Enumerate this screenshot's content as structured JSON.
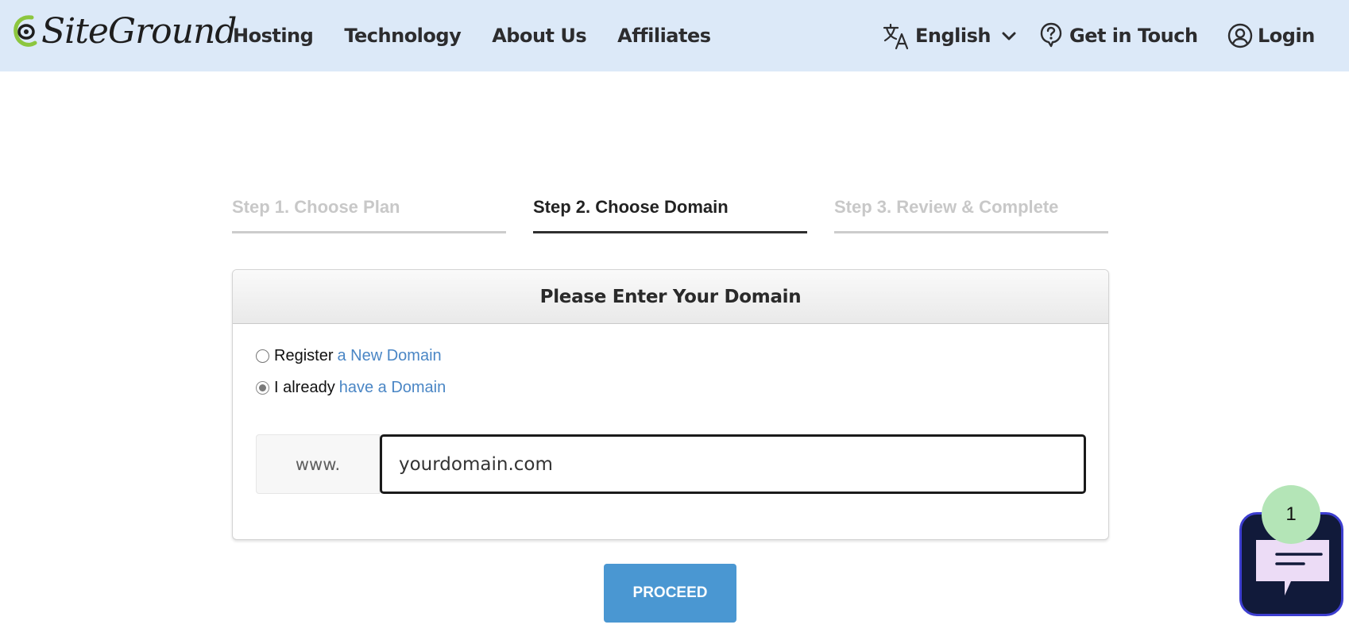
{
  "header": {
    "logo_text": "SiteGround",
    "nav": [
      {
        "label": "Hosting"
      },
      {
        "label": "Technology"
      },
      {
        "label": "About Us"
      },
      {
        "label": "Affiliates"
      }
    ],
    "language": {
      "label": "English",
      "icon": "translate-icon"
    },
    "get_in_touch": {
      "label": "Get in Touch",
      "icon": "question-bubble-icon"
    },
    "login": {
      "label": "Login",
      "icon": "user-circle-icon"
    }
  },
  "steps": [
    {
      "label": "Step 1. Choose Plan",
      "active": false
    },
    {
      "label": "Step 2. Choose Domain",
      "active": true
    },
    {
      "label": "Step 3. Review & Complete",
      "active": false
    }
  ],
  "card": {
    "title": "Please Enter Your Domain",
    "options": [
      {
        "prefix": "Register",
        "highlight": "a New Domain",
        "checked": false
      },
      {
        "prefix": "I already",
        "highlight": "have a Domain",
        "checked": true
      }
    ],
    "domain_prefix": "www.",
    "domain_placeholder": "yourdomain.com",
    "domain_value": ""
  },
  "proceed_label": "PROCEED",
  "chat": {
    "badge_count": "1",
    "colors": {
      "background": "#111a3a",
      "border": "#3d3ed0",
      "badge": "#b4e5b7"
    }
  },
  "colors": {
    "header_bg": "#dce9f8",
    "accent_link": "#4a86c5",
    "button": "#4a97d2",
    "logo_green": "#8cc63f"
  }
}
